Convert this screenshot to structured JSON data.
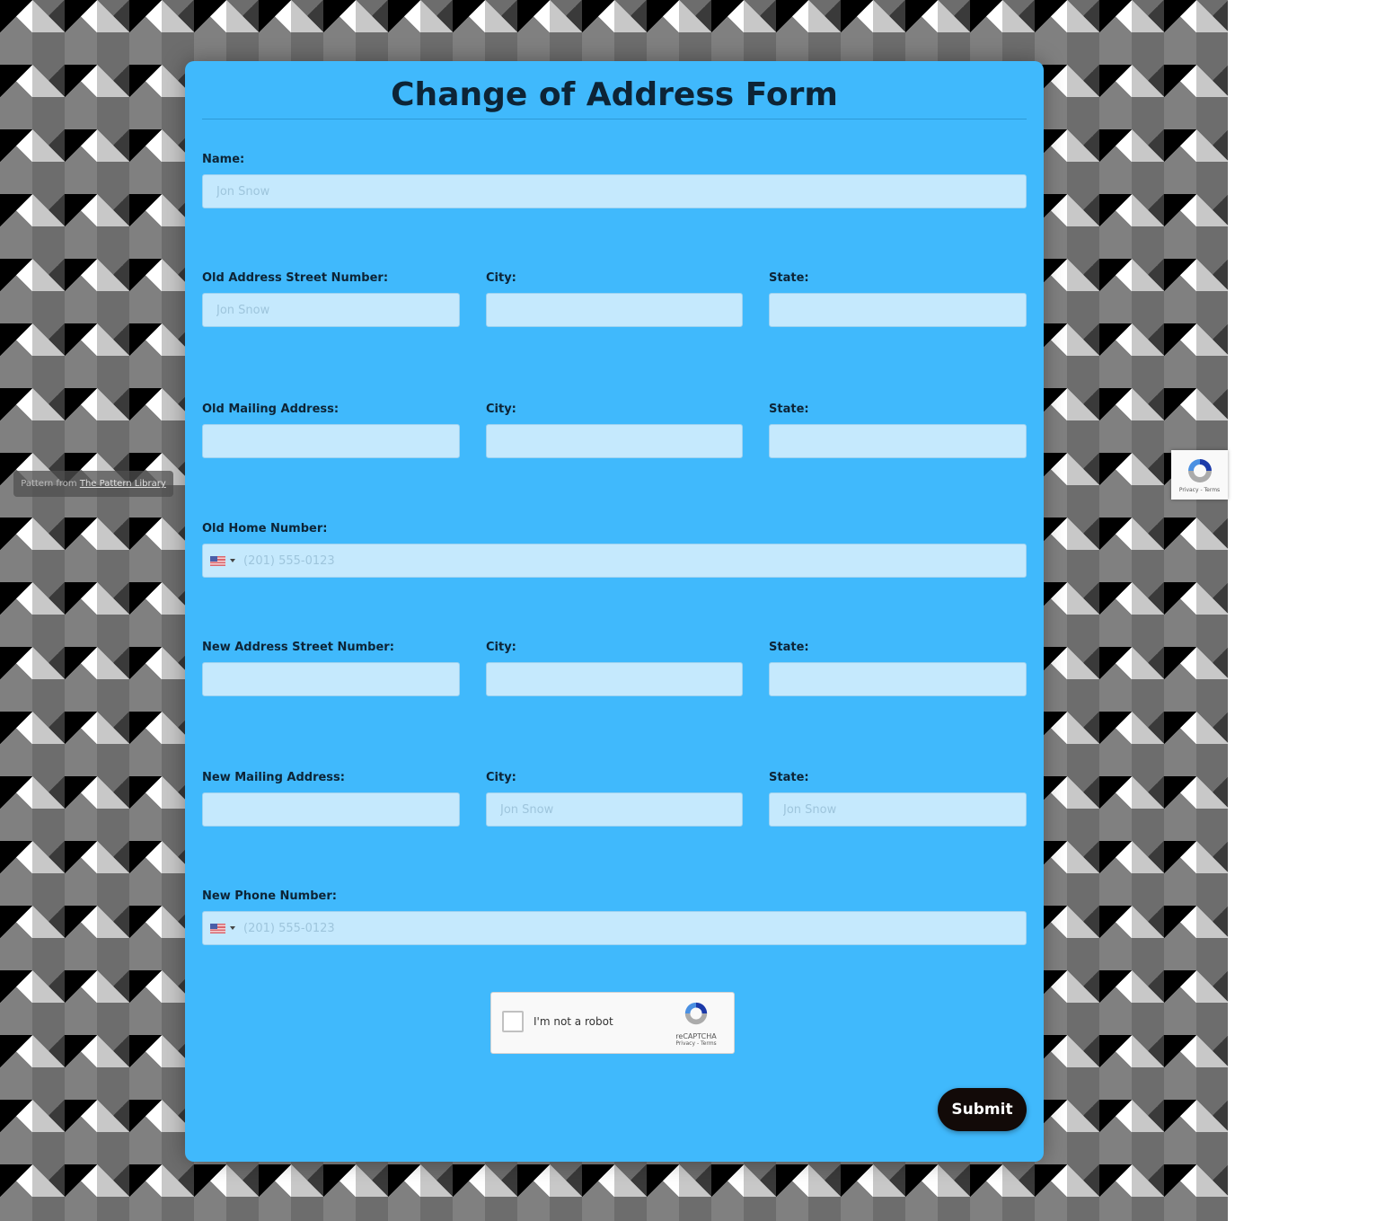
{
  "background": {
    "credit_prefix": "Pattern from ",
    "credit_link": "The Pattern Library"
  },
  "recaptcha_badge": {
    "terms": "Privacy - Terms"
  },
  "form": {
    "title": "Change of Address Form",
    "accent_color": "#40b9fc",
    "name": {
      "label": "Name:",
      "placeholder": "Jon Snow",
      "value": ""
    },
    "old_address": {
      "street": {
        "label": "Old Address Street Number:",
        "placeholder": "Jon Snow",
        "value": ""
      },
      "city": {
        "label": "City:",
        "placeholder": "",
        "value": ""
      },
      "state": {
        "label": "State:",
        "placeholder": "",
        "value": ""
      }
    },
    "old_mailing": {
      "address": {
        "label": "Old Mailing Address:",
        "placeholder": "",
        "value": ""
      },
      "city": {
        "label": "City:",
        "placeholder": "",
        "value": ""
      },
      "state": {
        "label": "State:",
        "placeholder": "",
        "value": ""
      }
    },
    "old_home_number": {
      "label": "Old Home Number:",
      "country": "US",
      "placeholder": "(201) 555-0123",
      "value": ""
    },
    "new_address": {
      "street": {
        "label": "New Address Street Number:",
        "placeholder": "",
        "value": ""
      },
      "city": {
        "label": "City:",
        "placeholder": "",
        "value": ""
      },
      "state": {
        "label": "State:",
        "placeholder": "",
        "value": ""
      }
    },
    "new_mailing": {
      "address": {
        "label": "New Mailing Address:",
        "placeholder": "",
        "value": ""
      },
      "city": {
        "label": "City:",
        "placeholder": "Jon Snow",
        "value": ""
      },
      "state": {
        "label": "State:",
        "placeholder": "Jon Snow",
        "value": ""
      }
    },
    "new_phone_number": {
      "label": "New Phone Number:",
      "country": "US",
      "placeholder": "(201) 555-0123",
      "value": ""
    },
    "captcha": {
      "text": "I'm not a robot",
      "brand": "reCAPTCHA",
      "terms": "Privacy - Terms",
      "checked": false
    },
    "submit_label": "Submit"
  }
}
